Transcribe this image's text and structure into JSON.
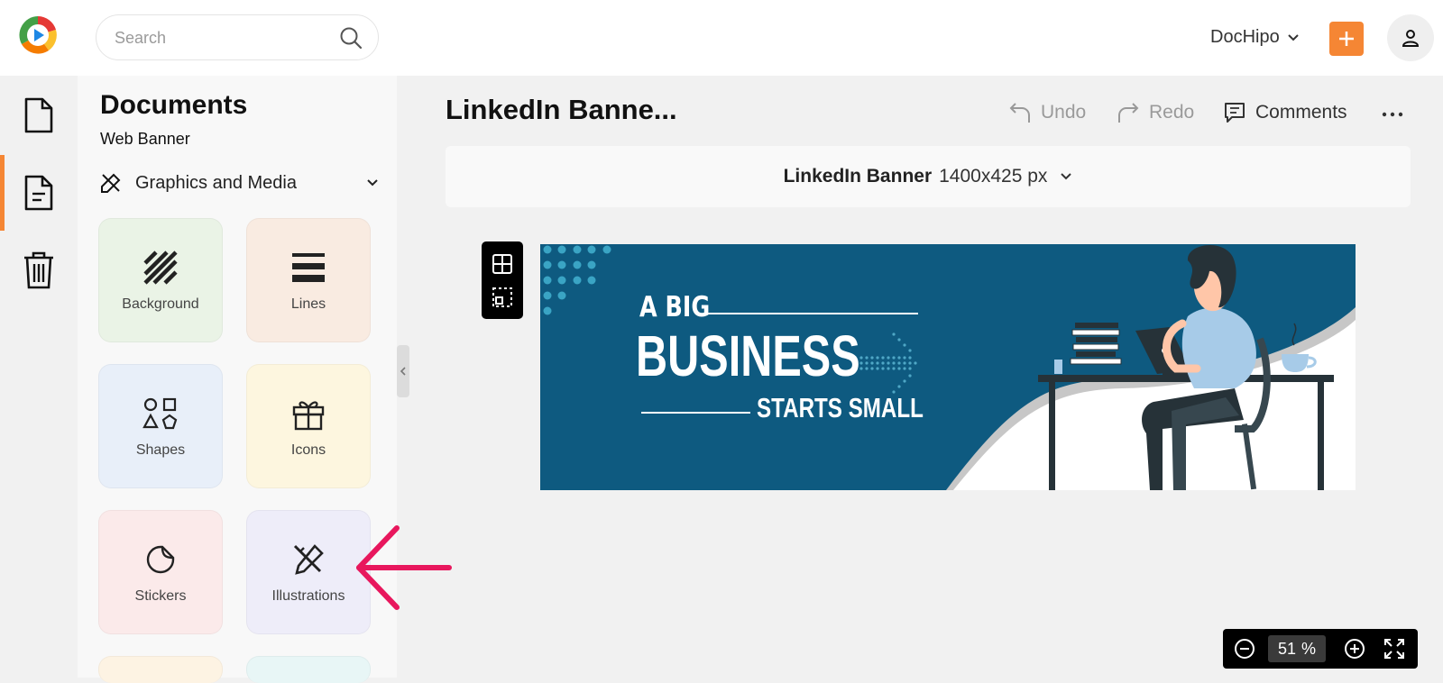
{
  "app": {
    "name": "DocHipo"
  },
  "search": {
    "placeholder": "Search"
  },
  "header": {
    "workspace_label": "DocHipo"
  },
  "colors": {
    "accent": "#f58634",
    "banner_bg": "#0e5a80",
    "annotation": "#e8175d"
  },
  "panel": {
    "title": "Documents",
    "subtitle": "Web Banner",
    "category": "Graphics and Media",
    "tiles": [
      {
        "label": "Background",
        "icon": "background-pattern-icon",
        "color": "#eaf3e6"
      },
      {
        "label": "Lines",
        "icon": "lines-icon",
        "color": "#f9ebe1"
      },
      {
        "label": "Shapes",
        "icon": "shapes-icon",
        "color": "#e8eff9"
      },
      {
        "label": "Icons",
        "icon": "gift-icon",
        "color": "#fdf6df"
      },
      {
        "label": "Stickers",
        "icon": "sticker-icon",
        "color": "#fbeaea"
      },
      {
        "label": "Illustrations",
        "icon": "illustration-pen-icon",
        "color": "#eeedf9"
      }
    ]
  },
  "document": {
    "title": "LinkedIn Banne...",
    "size_name": "LinkedIn Banner",
    "size_dims": "1400x425 px"
  },
  "toolbar": {
    "undo": "Undo",
    "redo": "Redo",
    "comments": "Comments"
  },
  "banner": {
    "line1": "A BIG",
    "line2": "BUSINESS",
    "line3": "STARTS SMALL"
  },
  "zoom": {
    "value": "51",
    "unit": "%"
  }
}
